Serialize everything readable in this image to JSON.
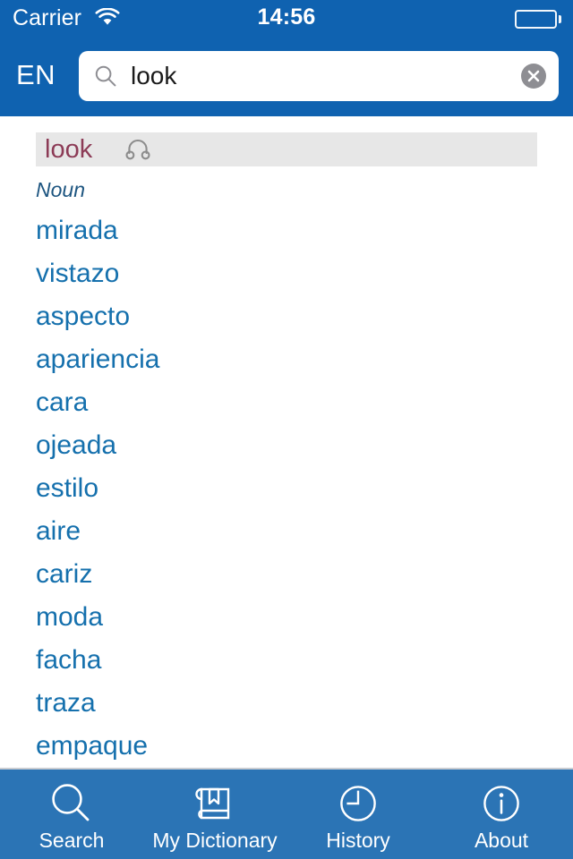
{
  "status_bar": {
    "carrier": "Carrier",
    "time": "14:56",
    "wifi_icon": "wifi-icon",
    "battery_icon": "battery-empty-icon"
  },
  "header": {
    "language_badge": "EN",
    "search": {
      "value": "look",
      "placeholder": "Search",
      "search_icon": "search-icon",
      "clear_icon": "clear-circle-icon"
    },
    "background_color": "#0f62b0"
  },
  "entry": {
    "headword": "look",
    "audio_icon": "headphones-icon",
    "band_color": "#e7e7e7",
    "headword_color": "#8c3b56",
    "part_of_speech": "Noun",
    "translations": [
      "mirada",
      "vistazo",
      "aspecto",
      "apariencia",
      "cara",
      "ojeada",
      "estilo",
      "aire",
      "cariz",
      "moda",
      "facha",
      "traza",
      "empaque"
    ],
    "translation_color": "#1570ad"
  },
  "tab_bar": {
    "background_color": "#2b74b5",
    "items": [
      {
        "label": "Search",
        "icon": "magnifier-icon"
      },
      {
        "label": "My Dictionary",
        "icon": "book-bookmark-icon"
      },
      {
        "label": "History",
        "icon": "clock-icon"
      },
      {
        "label": "About",
        "icon": "info-circle-icon"
      }
    ]
  }
}
